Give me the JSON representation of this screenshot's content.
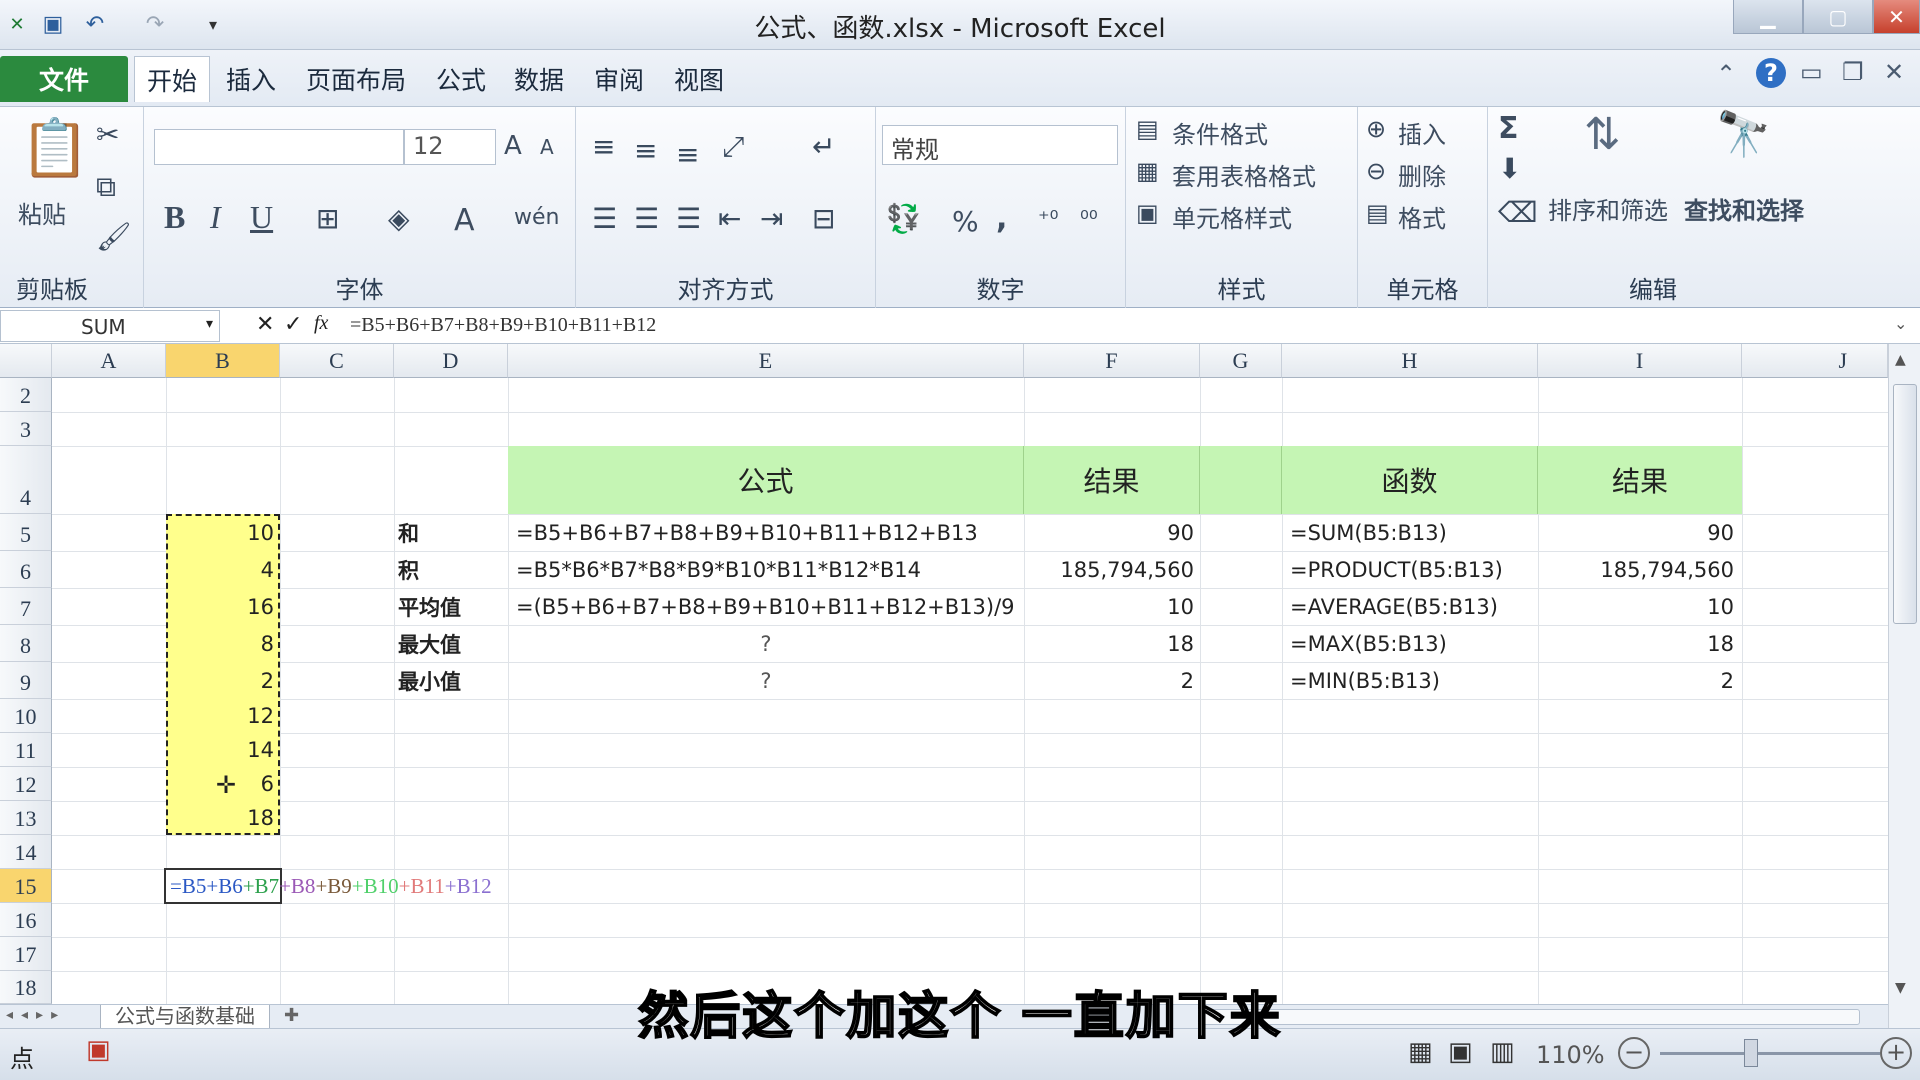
{
  "window": {
    "title": "公式、函数.xlsx - Microsoft Excel",
    "min_icon": "minimize-icon",
    "max_icon": "restore-icon",
    "close_label": "✕"
  },
  "quick_access": {
    "save_icon": "save-icon",
    "undo_icon": "undo-icon",
    "redo_icon": "redo-icon"
  },
  "menu": {
    "tabs": [
      {
        "label": "文件"
      },
      {
        "label": "开始"
      },
      {
        "label": "插入"
      },
      {
        "label": "页面布局"
      },
      {
        "label": "公式"
      },
      {
        "label": "数据"
      },
      {
        "label": "审阅"
      },
      {
        "label": "视图"
      }
    ]
  },
  "ribbon": {
    "clipboard": {
      "label": "剪贴板",
      "paste": "粘贴"
    },
    "font": {
      "label": "字体",
      "size": "12",
      "bold": "B",
      "italic": "I",
      "underline": "U",
      "grow": "A",
      "shrink": "A",
      "color": "A",
      "phonetic": "wén"
    },
    "alignment": {
      "label": "对齐方式"
    },
    "number": {
      "label": "数字",
      "format": "常规",
      "percent": "%",
      "comma": ","
    },
    "styles": {
      "label": "样式",
      "conditional": "条件格式",
      "table": "套用表格格式",
      "cell": "单元格样式"
    },
    "cells": {
      "label": "单元格",
      "insert": "插入",
      "delete": "删除",
      "format": "格式"
    },
    "editing": {
      "label": "编辑",
      "sum": "Σ",
      "sort": "排序和筛选",
      "find": "查找和选择"
    }
  },
  "formula_bar": {
    "name_box": "SUM",
    "cancel": "✕",
    "confirm": "✓",
    "fx": "fx",
    "formula": "=B5+B6+B7+B8+B9+B10+B11+B12"
  },
  "grid": {
    "columns": [
      "A",
      "B",
      "C",
      "D",
      "E",
      "F",
      "G",
      "H",
      "I",
      "J"
    ],
    "rows": [
      "2",
      "3",
      "4",
      "5",
      "6",
      "7",
      "8",
      "9",
      "10",
      "11",
      "12",
      "13",
      "14",
      "15",
      "16",
      "17",
      "18"
    ],
    "b_values": [
      "10",
      "4",
      "16",
      "8",
      "2",
      "12",
      "14",
      "6",
      "18"
    ],
    "header": {
      "e": "公式",
      "f": "结果",
      "h": "函数",
      "i": "结果"
    },
    "data": [
      {
        "d": "和",
        "e": "=B5+B6+B7+B8+B9+B10+B11+B12+B13",
        "f": "90",
        "h": "=SUM(B5:B13)",
        "i": "90"
      },
      {
        "d": "积",
        "e": "=B5*B6*B7*B8*B9*B10*B11*B12*B14",
        "f": "185,794,560",
        "h": "=PRODUCT(B5:B13)",
        "i": "185,794,560"
      },
      {
        "d": "平均值",
        "e": "=(B5+B6+B7+B8+B9+B10+B11+B12+B13)/9",
        "f": "10",
        "h": "=AVERAGE(B5:B13)",
        "i": "10"
      },
      {
        "d": "最大值",
        "e": "?",
        "f": "18",
        "h": "=MAX(B5:B13)",
        "i": "18"
      },
      {
        "d": "最小值",
        "e": "?",
        "f": "2",
        "h": "=MIN(B5:B13)",
        "i": "2"
      }
    ],
    "b15_formula_parts": [
      "=B5",
      "+B6",
      "+B7",
      "+B8",
      "+B9",
      "+B10",
      "+B11",
      "+B12"
    ],
    "ref_colors": [
      "#2b58c4",
      "#2b58c4",
      "#2ca04c",
      "#9b59b6",
      "#7a5a3a",
      "#4fd06a",
      "#e17a7a",
      "#8a6fd0",
      "#6f8fd0"
    ]
  },
  "sheet_tab": {
    "name": "公式与函数基础"
  },
  "status": {
    "mode": "点",
    "zoom": "110%"
  },
  "subtitle": "然后这个加这个 一直加下来"
}
